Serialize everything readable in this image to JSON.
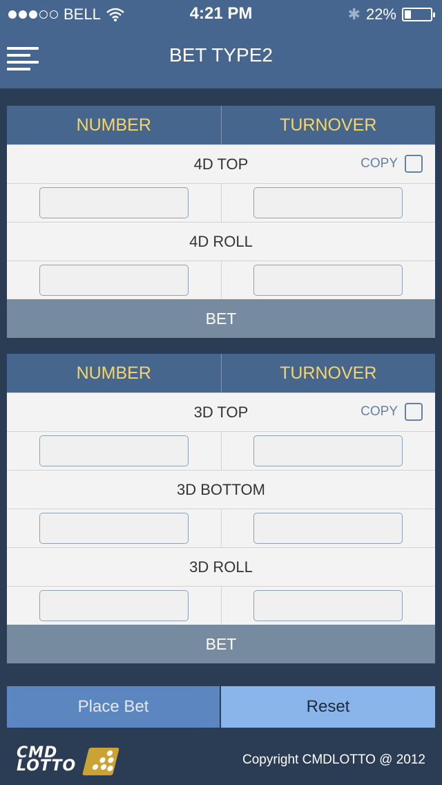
{
  "status": {
    "carrier": "BELL",
    "time": "4:21 PM",
    "battery": "22%",
    "battery_level": 0.22,
    "signal_bars": 3,
    "signal_total": 5
  },
  "nav": {
    "title": "BET TYPE2"
  },
  "section1": {
    "col_number": "NUMBER",
    "col_turnover": "TURNOVER",
    "row1_label": "4D TOP",
    "copy_label": "COPY",
    "row2_label": "4D ROLL",
    "bet_label": "BET"
  },
  "section2": {
    "col_number": "NUMBER",
    "col_turnover": "TURNOVER",
    "row1_label": "3D TOP",
    "copy_label": "COPY",
    "row2_label": "3D BOTTOM",
    "row3_label": "3D ROLL",
    "bet_label": "BET"
  },
  "actions": {
    "place_bet": "Place Bet",
    "reset": "Reset"
  },
  "footer": {
    "logo_line1": "CMD",
    "logo_line2": "LOTTO",
    "copyright": "Copyright CMDLOTTO @ 2012"
  },
  "colors": {
    "header_bg": "#466690",
    "page_bg": "#2b3c55",
    "accent_text": "#f6d66a",
    "bet_button": "#768aa0",
    "place_bet": "#5c86bf",
    "reset": "#8ab5ea"
  }
}
